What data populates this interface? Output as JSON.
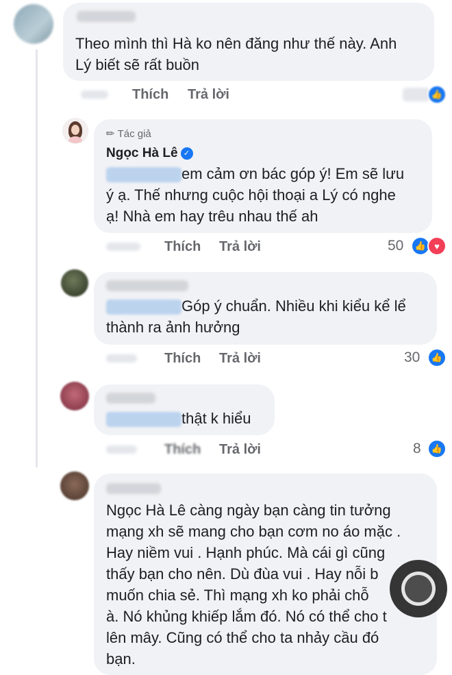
{
  "comments": [
    {
      "text": "Theo mình thì Hà ko nên đăng như thế này.  Anh Lý biết sẽ rất buồn",
      "line1": "Theo mình thì Hà ko nên đăng như thế này.  Anh",
      "line2": "Lý biết sẽ rất buồn",
      "like_label": "Thích",
      "reply_label": "Trả lời"
    },
    {
      "author_badge": "Tác giả",
      "author_name": "Ngọc Hà Lê",
      "line1": "em cảm ơn bác góp ý! Em sẽ lưu",
      "line2": "ý ạ. Thế nhưng cuộc hội thoại a Lý có nghe",
      "line3": "ạ! Nhà em hay trêu nhau thế ah",
      "like_label": "Thích",
      "reply_label": "Trả lời",
      "reaction_count": "50"
    },
    {
      "line1": "Góp ý chuẩn. Nhiều khi kiểu kể lể",
      "line2": "thành ra ảnh hưởng",
      "like_label": "Thích",
      "reply_label": "Trả lời",
      "reaction_count": "30"
    },
    {
      "line1": "thật k hiểu",
      "like_label": "Thích",
      "reply_label": "Trả lời",
      "reaction_count": "8"
    },
    {
      "line1": "Ngọc Hà Lê càng ngày bạn càng tin tưởng",
      "line2": "mạng xh sẽ mang cho bạn cơm  no áo mặc .",
      "line3": "Hay niềm vui . Hạnh phúc. Mà cái gì cũng",
      "line4": "thấy bạn cho nên. Dù đùa vui . Hay nỗi b",
      "line5": "muốn chia sẻ. Thì mạng xh ko phải chỗ",
      "line6": "à. Nó khủng khiếp lắm đó. Nó có thể cho t",
      "line7": "lên mây. Cũng có thể cho ta nhảy cầu đó",
      "line8": "bạn."
    }
  ],
  "colors": {
    "bubble": "#f0f2f5",
    "action_text": "#65676b",
    "like_blue": "#1877f2",
    "heart_red": "#f33e58"
  }
}
